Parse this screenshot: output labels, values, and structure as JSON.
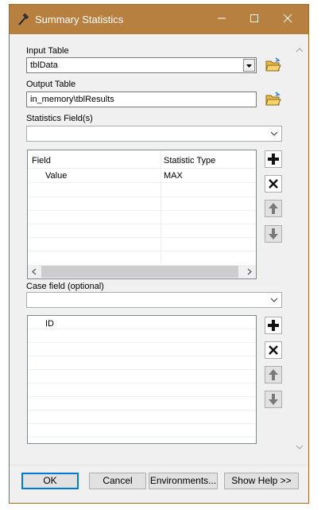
{
  "window": {
    "title": "Summary Statistics",
    "icon": "hammer-icon",
    "controls": {
      "minimize": "—",
      "maximize": "☐",
      "close": "✕"
    }
  },
  "input_table": {
    "label": "Input Table",
    "value": "tblData"
  },
  "output_table": {
    "label": "Output Table",
    "value": "in_memory\\tblResults"
  },
  "statistics_fields": {
    "label": "Statistics Field(s)",
    "columns": [
      "Field",
      "Statistic Type"
    ],
    "rows": [
      {
        "field": "Value",
        "statistic": "MAX"
      }
    ]
  },
  "case_field": {
    "label": "Case field (optional)",
    "items": [
      "ID"
    ]
  },
  "buttons": {
    "ok": "OK",
    "cancel": "Cancel",
    "environments": "Environments...",
    "show_help": "Show Help >>"
  },
  "colors": {
    "titlebar": "#b88040",
    "window_border": "#a56a20",
    "focus_blue": "#0078d7"
  }
}
